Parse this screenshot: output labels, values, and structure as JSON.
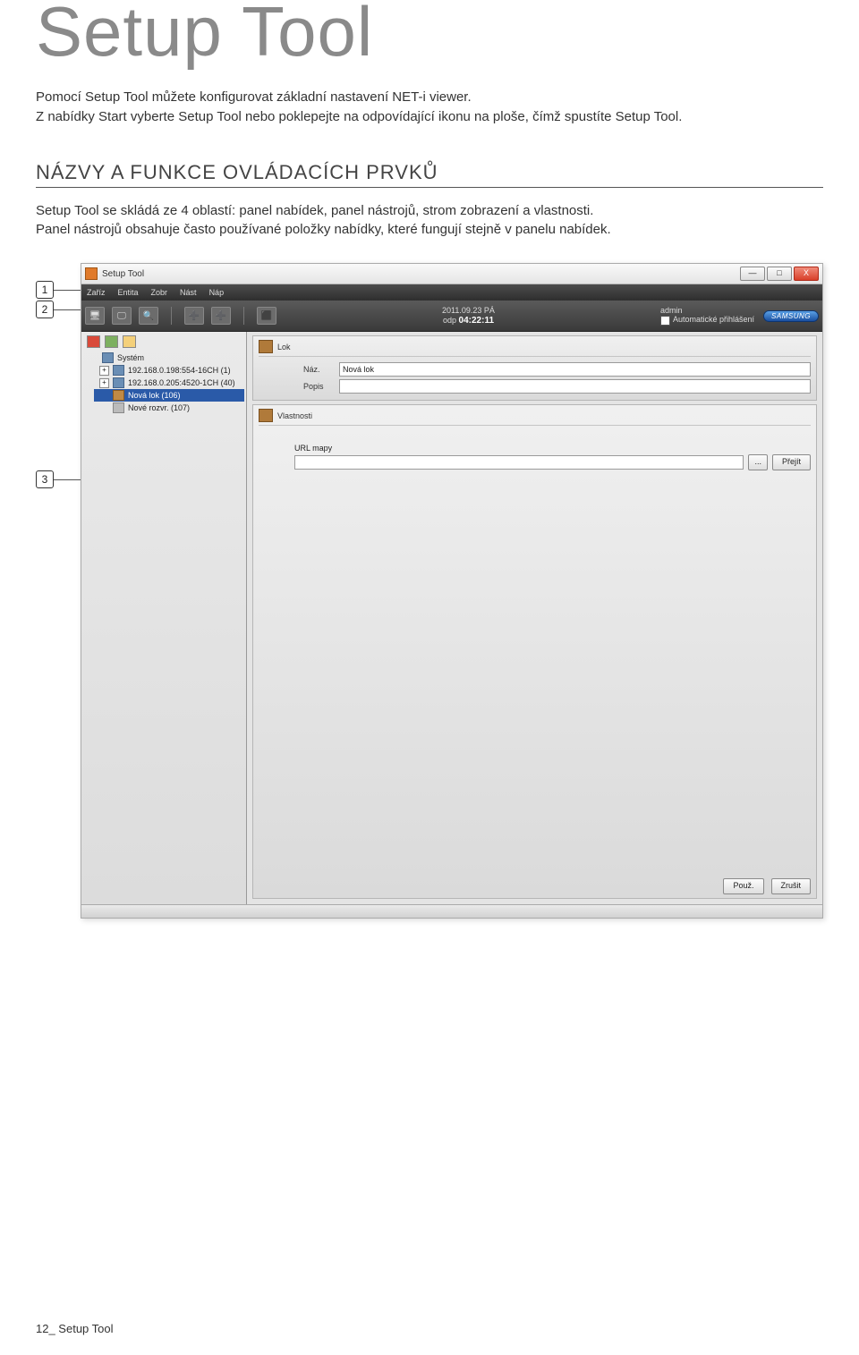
{
  "page_title": "Setup Tool",
  "intro1": "Pomocí Setup Tool můžete konfigurovat základní nastavení NET-i viewer.",
  "intro2": "Z nabídky Start vyberte Setup Tool nebo poklepejte na odpovídající ikonu na ploše, čímž spustíte Setup Tool.",
  "section_heading": "NÁZVY A FUNKCE OVLÁDACÍCH PRVKŮ",
  "section_body1": "Setup Tool se skládá ze 4 oblastí: panel nabídek, panel nástrojů, strom zobrazení a vlastnosti.",
  "section_body2": "Panel nástrojů obsahuje často používané položky nabídky, které fungují stejně v panelu nabídek.",
  "callout1": "1",
  "callout2": "2",
  "callout3": "3",
  "footer": "12_ Setup Tool",
  "win": {
    "title": "Setup Tool",
    "minimize": "—",
    "maximize": "□",
    "close": "X"
  },
  "menu": {
    "m1": "Zaříz",
    "m2": "Entita",
    "m3": "Zobr",
    "m4": "Nást",
    "m5": "Náp"
  },
  "toolbar": {
    "date": "2011.09.23 PÁ",
    "time_prefix": "odp",
    "time": "04:22:11",
    "user": "admin",
    "autologin": "Automatické přihlášení",
    "brand": "SAMSUNG"
  },
  "tree": {
    "root": "Systém",
    "n1": "192.168.0.198:554-16CH (1)",
    "n2": "192.168.0.205:4520-1CH (40)",
    "n3": "Nová lok (106)",
    "n4": "Nové rozvr. (107)"
  },
  "pane": {
    "head1": "Lok",
    "label_name": "Náz.",
    "value_name": "Nová lok",
    "label_desc": "Popis",
    "value_desc": "",
    "head2": "Vlastnosti",
    "label_url": "URL mapy",
    "btn_browse": "...",
    "btn_go": "Přejít",
    "btn_apply": "Použ.",
    "btn_cancel": "Zrušit"
  }
}
